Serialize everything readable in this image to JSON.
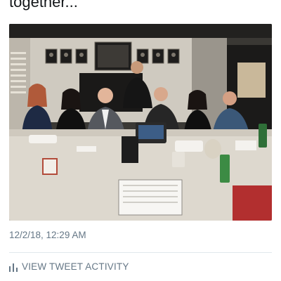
{
  "tweet": {
    "text_fragment": "together..."
  },
  "timestamp": "12/2/18, 12:29 AM",
  "activity": {
    "label": "VIEW TWEET ACTIVITY",
    "icon": "bar-chart-icon"
  },
  "colors": {
    "text": "#14171a",
    "secondary": "#657786",
    "divider": "#e1e8ed"
  }
}
